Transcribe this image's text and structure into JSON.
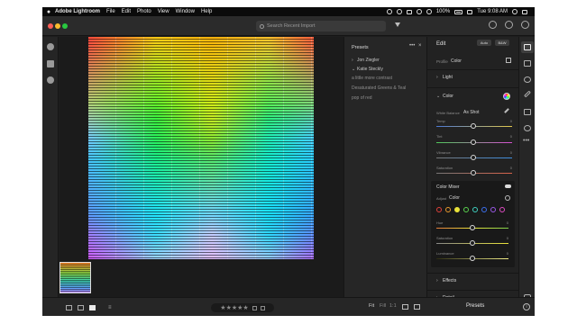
{
  "menubar": {
    "apple_glyph": "",
    "app_name": "Adobe Lightroom",
    "menus": [
      "File",
      "Edit",
      "Photo",
      "View",
      "Window",
      "Help"
    ],
    "battery": "100%",
    "day_time": "Tue 9:08 AM"
  },
  "titlebar": {
    "search_placeholder": "Search Recent Import"
  },
  "presets_panel": {
    "title": "Presets",
    "more_glyph": "•••",
    "close_glyph": "×",
    "groups": [
      {
        "name": "Jon Ziegler",
        "expanded": false
      },
      {
        "name": "Katie Steckly",
        "expanded": true
      }
    ],
    "presets": [
      "a little more contrast",
      "Desaturated Greens & Teal",
      "pop of red"
    ]
  },
  "edit_panel": {
    "title": "Edit",
    "auto_label": "Auto",
    "bw_label": "B&W",
    "profile_label": "Profile",
    "profile_value": "Color",
    "sections": {
      "light": "Light",
      "color": "Color",
      "effects": "Effects",
      "detail": "Detail"
    },
    "white_balance_label": "White Balance",
    "white_balance_value": "As Shot",
    "sliders": [
      {
        "label": "Temp",
        "value": "0"
      },
      {
        "label": "Tint",
        "value": "0"
      },
      {
        "label": "Vibrance",
        "value": "0"
      },
      {
        "label": "Saturation",
        "value": "0"
      }
    ],
    "color_mixer": {
      "title": "Color Mixer",
      "adjust_label": "Adjust",
      "adjust_value": "Color",
      "swatches": [
        "#e0403a",
        "#e99a2d",
        "#e9e23a",
        "#5ad34f",
        "#3fd1c0",
        "#3b6ff0",
        "#9b59e8",
        "#e04cc4"
      ],
      "sliders": [
        {
          "label": "Hue",
          "value": "0"
        },
        {
          "label": "Saturation",
          "value": "0"
        },
        {
          "label": "Luminance",
          "value": "0"
        }
      ]
    }
  },
  "bottombar": {
    "stars": "★★★★★",
    "fit_label": "Fit",
    "fill_label": "Fill",
    "ratio_label": "1:1",
    "presets_label": "Presets",
    "sort_glyph": "≡",
    "info_glyph": "i"
  },
  "colors": {
    "accent": "#dcdcdc",
    "panel": "#222222",
    "background": "#1e1e1e"
  },
  "icons": [
    "add-photos-icon",
    "library-icon",
    "people-icon",
    "edit-sliders-icon",
    "crop-icon",
    "healing-icon",
    "brush-icon",
    "linear-gradient-icon",
    "radial-gradient-icon",
    "more-icon",
    "tag-icon",
    "info-icon"
  ]
}
